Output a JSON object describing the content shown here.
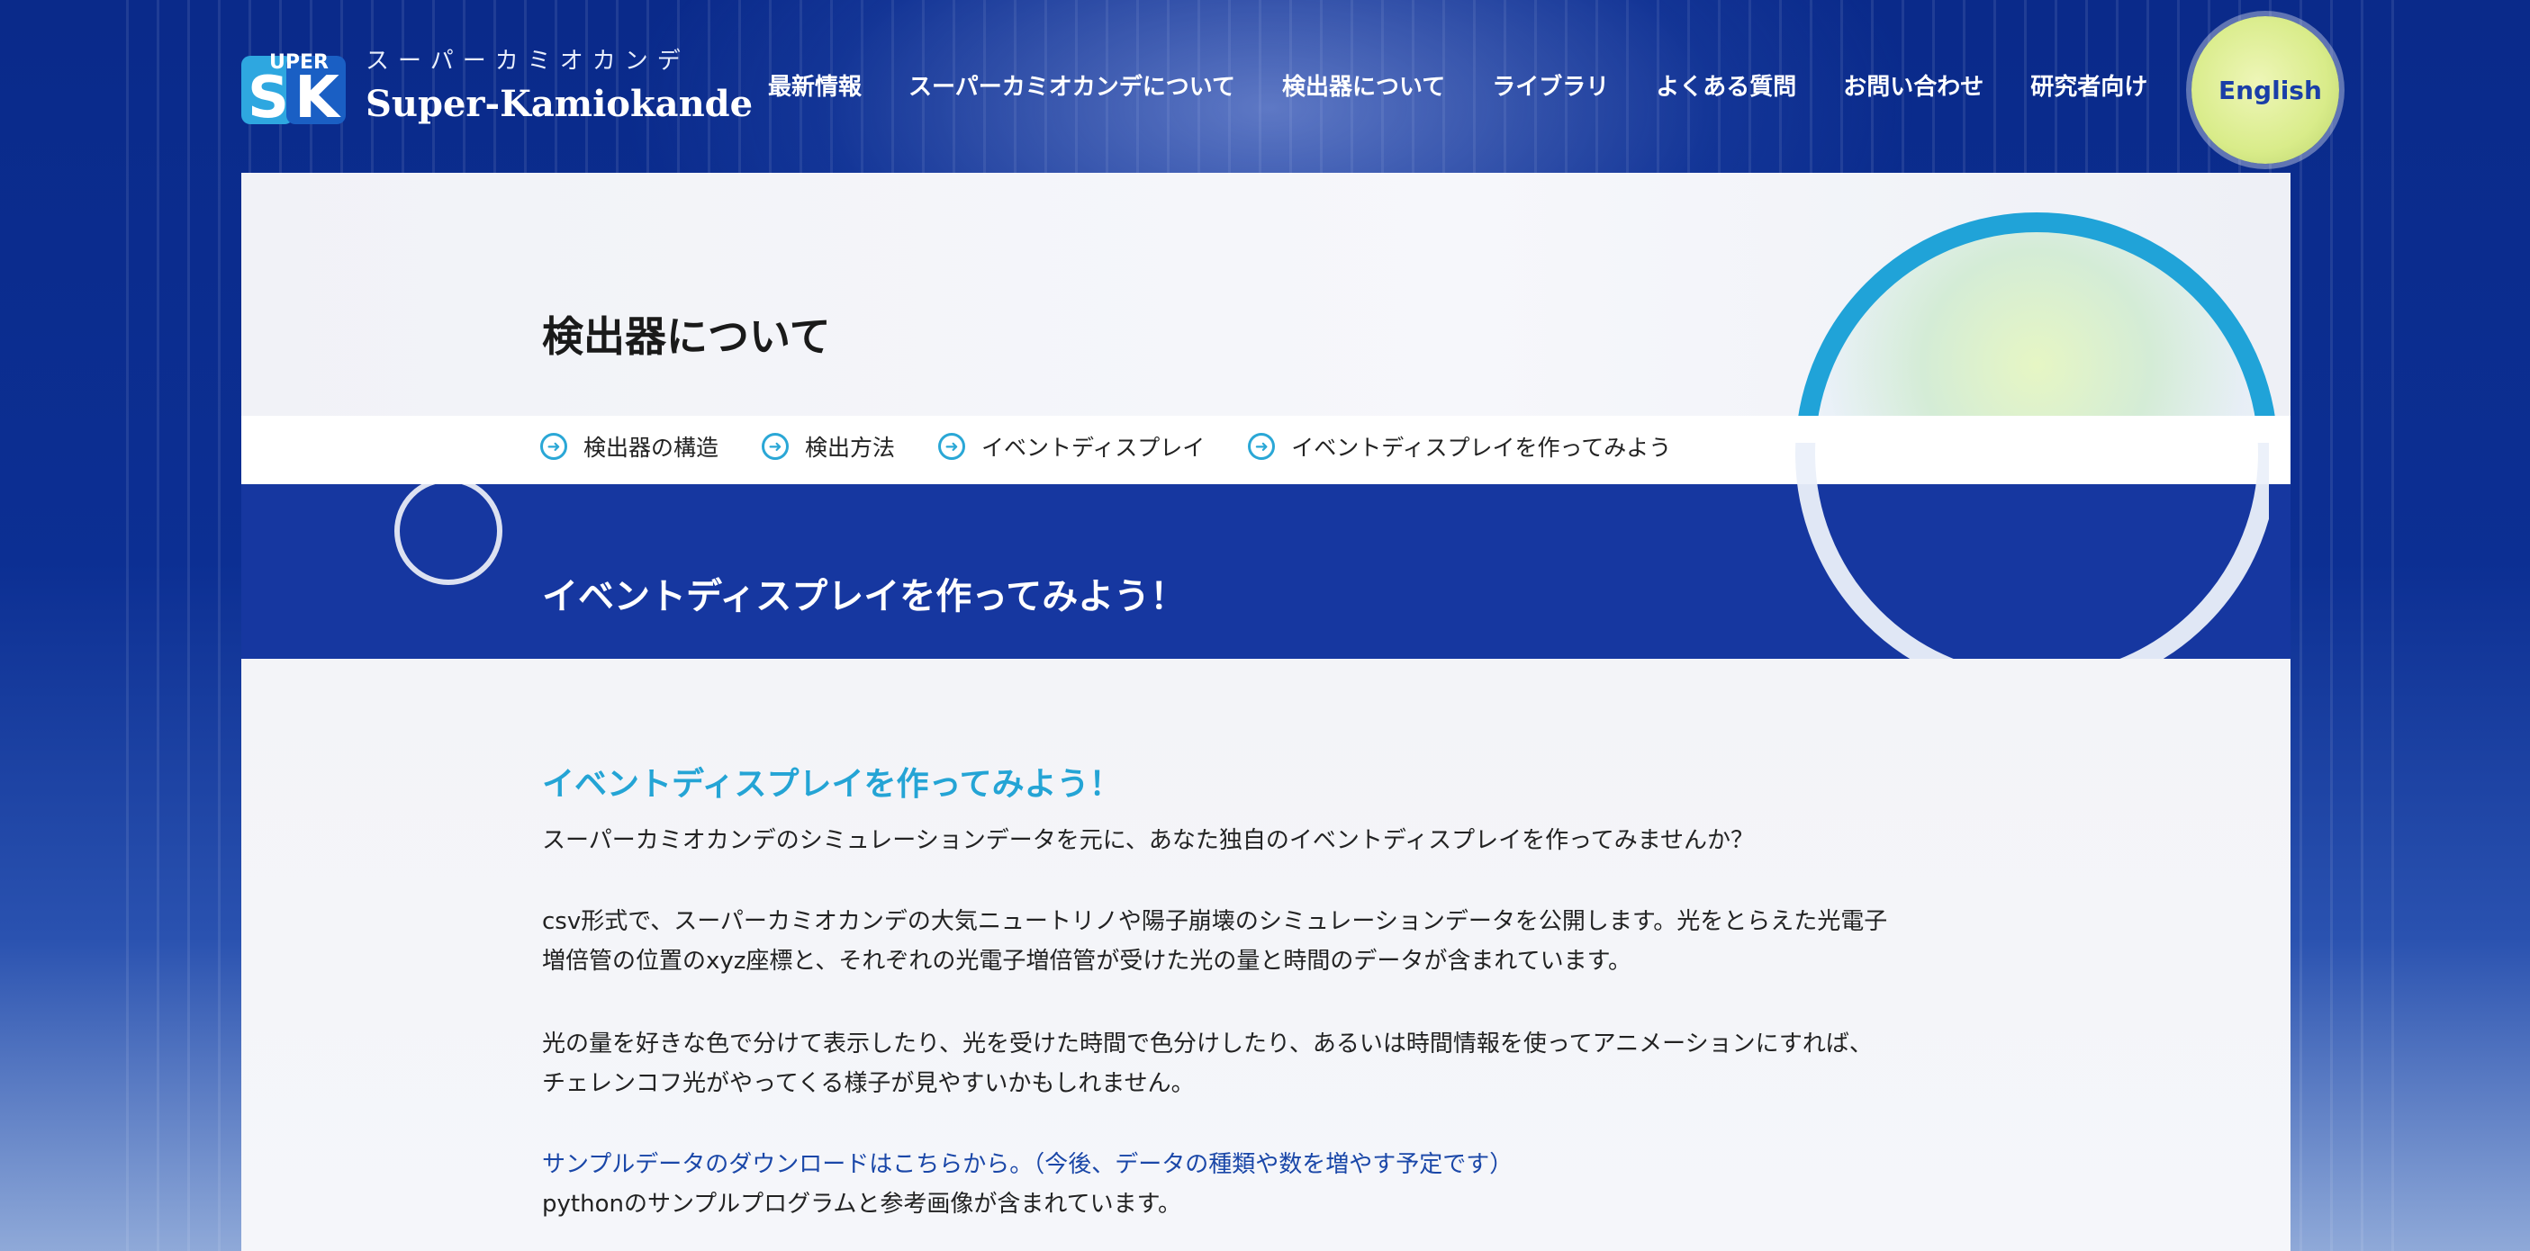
{
  "header": {
    "logo_jp": "スーパーカミオカンデ",
    "logo_en": "Super-Kamiokande",
    "nav": [
      "最新情報",
      "スーパーカミオカンデについて",
      "検出器について",
      "ライブラリ",
      "よくある質問",
      "お問い合わせ",
      "研究者向け"
    ],
    "lang_button": "English"
  },
  "page": {
    "title": "検出器について",
    "subnav": [
      "検出器の構造",
      "検出方法",
      "イベントディスプレイ",
      "イベントディスプレイを作ってみよう"
    ],
    "section_title": "イベントディスプレイを作ってみよう！"
  },
  "content": {
    "heading": "イベントディスプレイを作ってみよう！",
    "p1": "スーパーカミオカンデのシミュレーションデータを元に、あなた独自のイベントディスプレイを作ってみませんか？",
    "p2_line1": "csv形式で、スーパーカミオカンデの大気ニュートリノや陽子崩壊のシミュレーションデータを公開します。光をとらえた光電子",
    "p2_line2": "増倍管の位置のxyz座標と、それぞれの光電子増倍管が受けた光の量と時間のデータが含まれています。",
    "p3_line1": "光の量を好きな色で分けて表示したり、光を受けた時間で色分けしたり、あるいは時間情報を使ってアニメーションにすれば、",
    "p3_line2": "チェレンコフ光がやってくる様子が見やすいかもしれません。",
    "download_link": "サンプルデータのダウンロードはこちらから。（今後、データの種類や数を増やす予定です）",
    "p4": "pythonのサンプルプログラムと参考画像が含まれています。"
  },
  "colors": {
    "banner": "#1637a0",
    "accent": "#24a4d5",
    "link": "#1a47a8",
    "lang_button": "#d9ec8a"
  }
}
